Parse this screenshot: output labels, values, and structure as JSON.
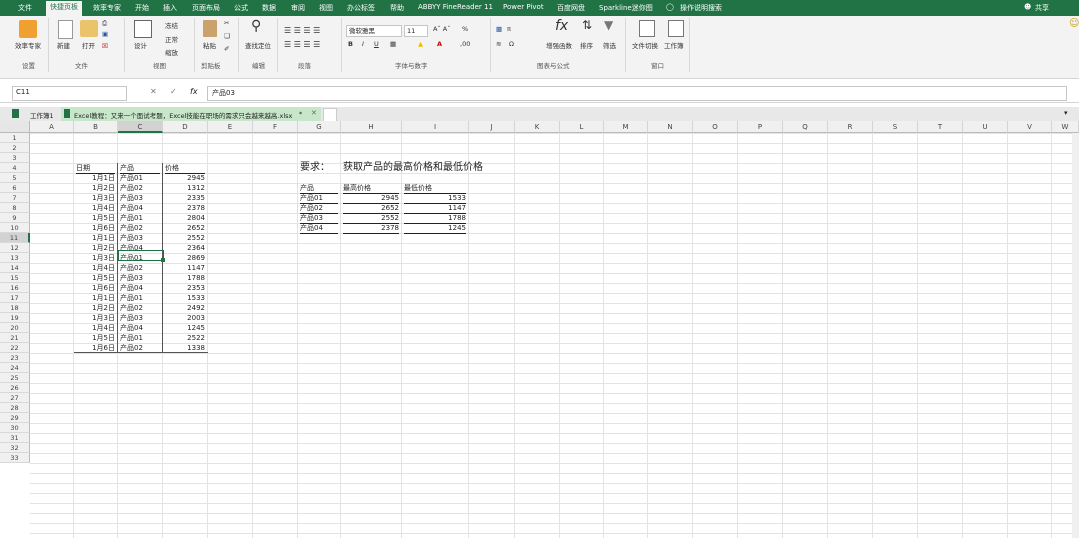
{
  "menu": {
    "tabs": [
      "文件",
      "快捷页板",
      "效率专家",
      "开始",
      "插入",
      "页面布局",
      "公式",
      "数据",
      "审阅",
      "视图",
      "办公标签",
      "帮助",
      "ABBYY FineReader 11",
      "Power Pivot",
      "百度网盘",
      "Sparkline迷你图"
    ],
    "active_index": 1,
    "search_hint": "操作说明搜索",
    "share": "共享"
  },
  "ribbon": {
    "btn_efficiency": "效率专家",
    "btn_new": "新建",
    "btn_open": "打开",
    "btn_design": "设计",
    "btn_freeze": "冻结",
    "btn_normal": "正常",
    "btn_zoom": "缩放",
    "btn_paste": "粘贴",
    "btn_find": "查找定位",
    "font_name": "微软雅黑",
    "font_size": "11",
    "btn_add_func": "增强函数",
    "btn_sort": "排序",
    "btn_filter": "筛选",
    "btn_file_switch": "文件切换",
    "btn_workbook": "工作簿",
    "groups": [
      "设置",
      "文件",
      "视图",
      "剪贴板",
      "编辑",
      "段落",
      "字体与数字",
      "图表与公式",
      "窗口"
    ]
  },
  "formula_bar": {
    "name_box": "C11",
    "content": "产品03"
  },
  "sheet_tabs": {
    "tab1": "工作簿1",
    "tab2": "Excel教程：又来一个面试考题，Excel技能在职场的需求只会越来越高.xlsx",
    "tab2_mark": "*"
  },
  "columns": [
    "A",
    "B",
    "C",
    "D",
    "E",
    "F",
    "G",
    "H",
    "I",
    "J",
    "K",
    "L",
    "M",
    "N",
    "O",
    "P",
    "Q",
    "R",
    "S",
    "T",
    "U",
    "V",
    "W"
  ],
  "rows": [
    "1",
    "2",
    "3",
    "4",
    "5",
    "6",
    "7",
    "8",
    "9",
    "10",
    "11",
    "12",
    "13",
    "14",
    "15",
    "16",
    "17",
    "18",
    "19",
    "20",
    "21",
    "22",
    "23",
    "24",
    "25",
    "26",
    "27",
    "28",
    "29",
    "30",
    "31",
    "32",
    "33"
  ],
  "table": {
    "headers": [
      "日期",
      "产品",
      "价格"
    ],
    "rows": [
      [
        "1月1日",
        "产品01",
        "2945"
      ],
      [
        "1月2日",
        "产品02",
        "1312"
      ],
      [
        "1月3日",
        "产品03",
        "2335"
      ],
      [
        "1月4日",
        "产品04",
        "2378"
      ],
      [
        "1月5日",
        "产品01",
        "2804"
      ],
      [
        "1月6日",
        "产品02",
        "2652"
      ],
      [
        "1月1日",
        "产品03",
        "2552"
      ],
      [
        "1月2日",
        "产品04",
        "2364"
      ],
      [
        "1月3日",
        "产品01",
        "2869"
      ],
      [
        "1月4日",
        "产品02",
        "1147"
      ],
      [
        "1月5日",
        "产品03",
        "1788"
      ],
      [
        "1月6日",
        "产品04",
        "2353"
      ],
      [
        "1月1日",
        "产品01",
        "1533"
      ],
      [
        "1月2日",
        "产品02",
        "2492"
      ],
      [
        "1月3日",
        "产品03",
        "2003"
      ],
      [
        "1月4日",
        "产品04",
        "1245"
      ],
      [
        "1月5日",
        "产品01",
        "2522"
      ],
      [
        "1月6日",
        "产品02",
        "1338"
      ]
    ]
  },
  "requirement": {
    "label": "要求：",
    "text": "获取产品的最高价格和最低价格"
  },
  "summary": {
    "headers": [
      "产品",
      "最高价格",
      "最低价格"
    ],
    "rows": [
      [
        "产品01",
        "2945",
        "1533"
      ],
      [
        "产品02",
        "2652",
        "1147"
      ],
      [
        "产品03",
        "2552",
        "1788"
      ],
      [
        "产品04",
        "2378",
        "1245"
      ]
    ]
  },
  "colors": {
    "excel_green": "#217346",
    "selected": "#217346"
  }
}
